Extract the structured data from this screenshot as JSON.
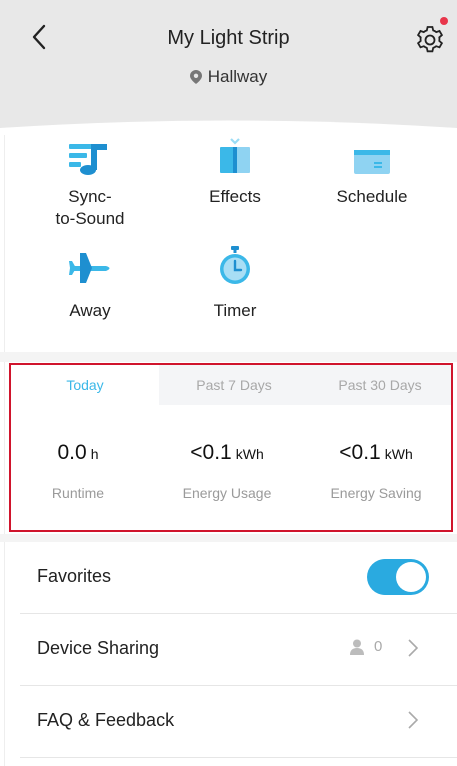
{
  "header": {
    "title": "My Light Strip",
    "location": "Hallway"
  },
  "features": [
    {
      "label": "Sync-\nto-Sound",
      "icon": "music-note-icon"
    },
    {
      "label": "Effects",
      "icon": "book-icon"
    },
    {
      "label": "Schedule",
      "icon": "calendar-icon"
    },
    {
      "label": "Away",
      "icon": "airplane-icon"
    },
    {
      "label": "Timer",
      "icon": "stopwatch-icon"
    }
  ],
  "stats": {
    "tabs": [
      "Today",
      "Past 7 Days",
      "Past 30 Days"
    ],
    "active_tab": "Today",
    "runtime": {
      "value": "0.0",
      "unit": "h",
      "caption": "Runtime"
    },
    "energy_usage": {
      "value": "<0.1",
      "unit": "kWh",
      "caption": "Energy Usage"
    },
    "energy_saving": {
      "value": "<0.1",
      "unit": "kWh",
      "caption": "Energy Saving"
    }
  },
  "settings": {
    "favorites": {
      "label": "Favorites",
      "enabled": true
    },
    "device_sharing": {
      "label": "Device Sharing",
      "count": "0"
    },
    "faq": {
      "label": "FAQ & Feedback"
    }
  },
  "colors": {
    "accent": "#3bb8e8",
    "toggle": "#2aaae0",
    "highlight_border": "#d0142c",
    "notification": "#e8364b"
  }
}
